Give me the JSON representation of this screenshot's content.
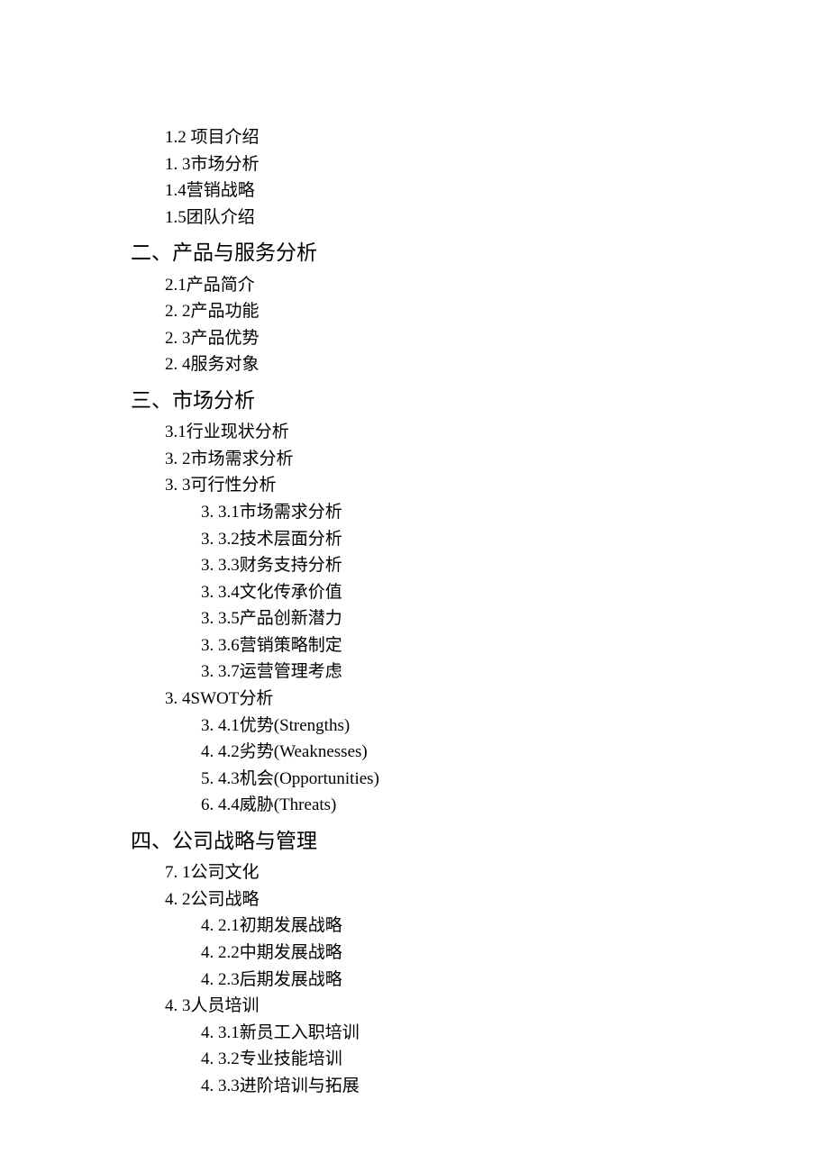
{
  "items": [
    {
      "class": "level1",
      "text": "1.2   项目介绍"
    },
    {
      "class": "level1",
      "text": "1.   3市场分析"
    },
    {
      "class": "level1",
      "text": "1.4营销战略"
    },
    {
      "class": "level1",
      "text": "1.5团队介绍"
    },
    {
      "class": "heading",
      "text": "二、产品与服务分析"
    },
    {
      "class": "level1",
      "text": "2.1产品简介"
    },
    {
      "class": "level1",
      "text": "2.   2产品功能"
    },
    {
      "class": "level1",
      "text": "2.   3产品优势"
    },
    {
      "class": "level1",
      "text": "2.   4服务对象"
    },
    {
      "class": "heading",
      "text": "三、市场分析"
    },
    {
      "class": "level1",
      "text": "3.1行业现状分析"
    },
    {
      "class": "level1",
      "text": "3.   2市场需求分析"
    },
    {
      "class": "level1",
      "text": "3.   3可行性分析"
    },
    {
      "class": "level2",
      "text": "3.   3.1市场需求分析"
    },
    {
      "class": "level2",
      "text": "3.   3.2技术层面分析"
    },
    {
      "class": "level2",
      "text": "3.   3.3财务支持分析"
    },
    {
      "class": "level2",
      "text": "3.   3.4文化传承价值"
    },
    {
      "class": "level2",
      "text": "3.   3.5产品创新潜力"
    },
    {
      "class": "level2",
      "text": "3.   3.6营销策略制定"
    },
    {
      "class": "level2",
      "text": "3.   3.7运营管理考虑"
    },
    {
      "class": "level1",
      "text": "3.   4SWOT分析"
    },
    {
      "class": "level2",
      "text": "3.   4.1优势(Strengths)"
    },
    {
      "class": "level2",
      "text": "4.   4.2劣势(Weaknesses)"
    },
    {
      "class": "level2",
      "text": "5.   4.3机会(Opportunities)"
    },
    {
      "class": "level2",
      "text": "6.   4.4威胁(Threats)"
    },
    {
      "class": "heading",
      "text": "四、公司战略与管理"
    },
    {
      "class": "level1",
      "text": "7.   1公司文化"
    },
    {
      "class": "level1",
      "text": "4.   2公司战略"
    },
    {
      "class": "level2",
      "text": "4.   2.1初期发展战略"
    },
    {
      "class": "level2",
      "text": "4.   2.2中期发展战略"
    },
    {
      "class": "level2",
      "text": "4.   2.3后期发展战略"
    },
    {
      "class": "level1",
      "text": "4.   3人员培训"
    },
    {
      "class": "level2",
      "text": "4.   3.1新员工入职培训"
    },
    {
      "class": "level2",
      "text": "4.   3.2专业技能培训"
    },
    {
      "class": "level2",
      "text": "4.   3.3进阶培训与拓展"
    }
  ]
}
